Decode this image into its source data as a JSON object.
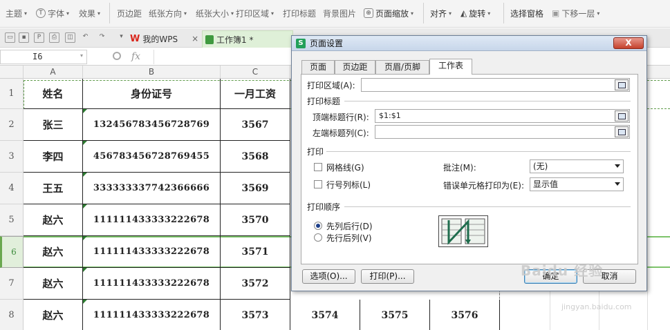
{
  "ribbon": {
    "items": [
      "主题",
      "字体",
      "效果",
      "页边距",
      "纸张方向",
      "纸张大小",
      "打印区域",
      "打印标题",
      "背景图片",
      "页面缩放",
      "对齐",
      "旋转",
      "选择窗格",
      "下移一层"
    ]
  },
  "tabs": {
    "wps_label": "我的WPS",
    "book_label": "工作簿1 *"
  },
  "formula_bar": {
    "cell_ref": "I6",
    "fx": "fx"
  },
  "columns": [
    "A",
    "B",
    "C"
  ],
  "rows": [
    "1",
    "2",
    "3",
    "4",
    "5",
    "6",
    "7",
    "8"
  ],
  "sheet": {
    "headers": [
      "姓名",
      "身份证号",
      "一月工资"
    ],
    "data": [
      [
        "张三",
        "132456783456728769",
        "3567"
      ],
      [
        "李四",
        "456783456728769455",
        "3568"
      ],
      [
        "王五",
        "333333337742366666",
        "3569"
      ],
      [
        "赵六",
        "111111433333222678",
        "3570"
      ],
      [
        "赵六",
        "111111433333222678",
        "3571"
      ],
      [
        "赵六",
        "111111433333222678",
        "3572"
      ],
      [
        "赵六",
        "111111433333222678",
        "3573"
      ]
    ],
    "row8_extra": [
      "3574",
      "3575",
      "3576"
    ]
  },
  "dialog": {
    "title": "页面设置",
    "close": "X",
    "tabs": [
      "页面",
      "页边距",
      "页眉/页脚",
      "工作表"
    ],
    "active_tab": "工作表",
    "print_area_label": "打印区域(A):",
    "print_area_value": "",
    "print_titles_group": "打印标题",
    "top_rows_label": "顶端标题行(R):",
    "top_rows_value": "$1:$1",
    "left_cols_label": "左端标题列(C):",
    "left_cols_value": "",
    "print_group": "打印",
    "gridlines_label": "网格线(G)",
    "rowcol_label": "行号列标(L)",
    "comments_label": "批注(M):",
    "comments_value": "(无)",
    "errors_label": "错误单元格打印为(E):",
    "errors_value": "显示值",
    "order_group": "打印顺序",
    "order_down_then_over": "先列后行(D)",
    "order_over_then_down": "先行后列(V)",
    "options_btn": "选项(O)...",
    "print_btn": "打印(P)...",
    "ok_btn": "确定",
    "cancel_btn": "取消"
  },
  "watermark": {
    "main": "Baidu 经验",
    "sub": "jingyan.baidu.com"
  }
}
